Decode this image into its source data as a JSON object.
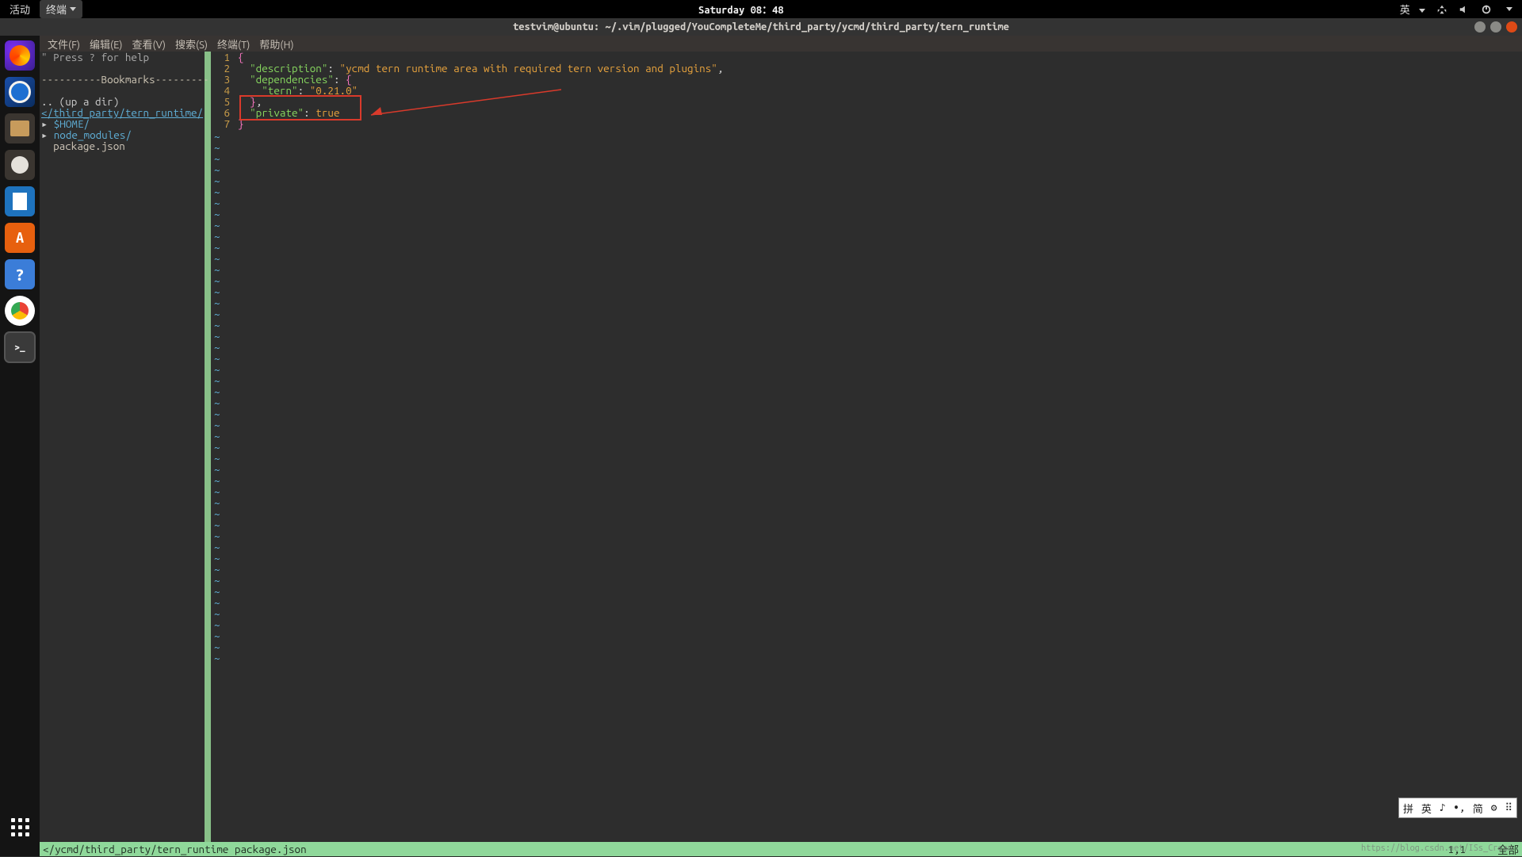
{
  "topbar": {
    "activity": "活动",
    "terminal": "终端",
    "datetime": "Saturday 08：48",
    "lang": "英"
  },
  "window": {
    "title": "testvim@ubuntu: ~/.vim/plugged/YouCompleteMe/third_party/ycmd/third_party/tern_runtime"
  },
  "menubar": {
    "file": "文件(F)",
    "edit": "编辑(E)",
    "view": "查看(V)",
    "search": "搜索(S)",
    "terminal": "终端(T)",
    "help": "帮助(H)"
  },
  "nerdtree": {
    "help": "\" Press ? for help",
    "bookmarks": "----------Bookmarks----------",
    "updir": ".. (up a dir)",
    "path": "</third_party/tern_runtime/",
    "home_entry": "$HOME",
    "node_modules": "node_modules",
    "package_json": "package.json"
  },
  "code": {
    "lines": [
      "1",
      "2",
      "3",
      "4",
      "5",
      "6",
      "7"
    ],
    "l1": "{",
    "l2_key": "\"description\"",
    "l2_val": "\"ycmd tern runtime area with required tern version and plugins\"",
    "l3_key": "\"dependencies\"",
    "l3_val": "{",
    "l4_key": "\"tern\"",
    "l4_val": "\"0.21.0\"",
    "l5": "},",
    "l6_key": "\"private\"",
    "l6_val": "true",
    "l7": "}"
  },
  "status": {
    "path": "</ycmd/third_party/tern_runtime package.json",
    "pos": "1,1",
    "scope": "全部"
  },
  "ime": {
    "t1": "拼",
    "t2": "英",
    "t3": "♪",
    "t4": "•,",
    "t5": "简",
    "t6": "⚙"
  },
  "watermark": "https://blog.csdn.net/ISs_Cream"
}
